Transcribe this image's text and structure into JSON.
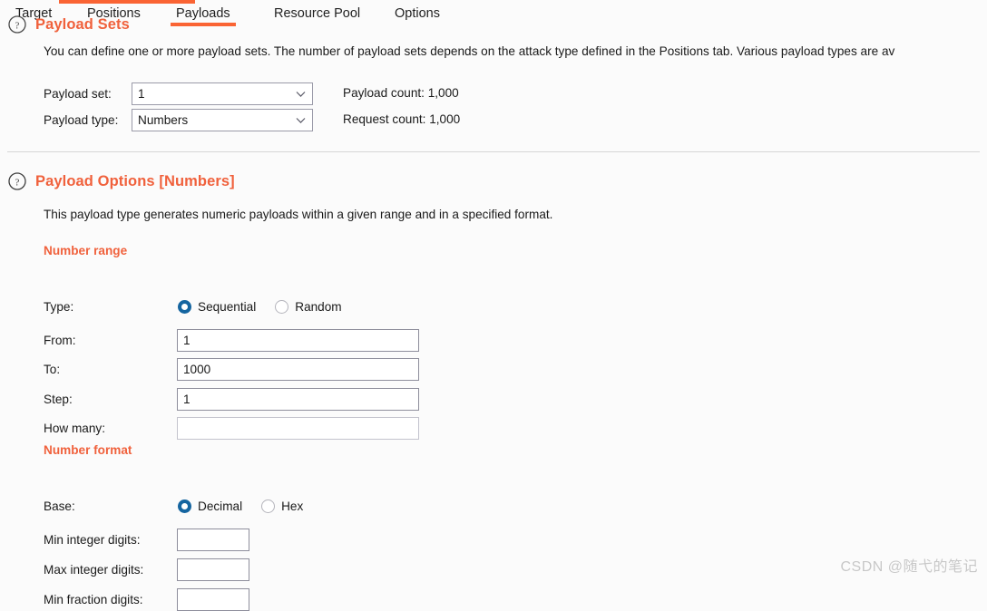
{
  "tabs": [
    {
      "label": "Target",
      "active": false
    },
    {
      "label": "Positions",
      "active": false
    },
    {
      "label": "Payloads",
      "active": true
    },
    {
      "label": "Resource Pool",
      "active": false
    },
    {
      "label": "Options",
      "active": false
    }
  ],
  "payload_sets": {
    "title": "Payload Sets",
    "help_icon": "question-circle-icon",
    "description": "You can define one or more payload sets. The number of payload sets depends on the attack type defined in the Positions tab. Various payload types are av",
    "payload_set": {
      "label": "Payload set:",
      "value": "1",
      "chevron_icon": "chevron-down-icon"
    },
    "payload_type": {
      "label": "Payload type:",
      "value": "Numbers",
      "chevron_icon": "chevron-down-icon"
    },
    "payload_count": "Payload count: 1,000",
    "request_count": "Request count: 1,000"
  },
  "payload_options": {
    "title": "Payload Options [Numbers]",
    "help_icon": "question-circle-icon",
    "description": "This payload type generates numeric payloads within a given range and in a specified format.",
    "number_range": {
      "heading": "Number range",
      "type": {
        "label": "Type:",
        "options": [
          {
            "label": "Sequential",
            "selected": true
          },
          {
            "label": "Random",
            "selected": false
          }
        ]
      },
      "fields": [
        {
          "label": "From:",
          "value": "1",
          "enabled": true
        },
        {
          "label": "To:",
          "value": "1000",
          "enabled": true
        },
        {
          "label": "Step:",
          "value": "1",
          "enabled": true
        },
        {
          "label": "How many:",
          "value": "",
          "enabled": false
        }
      ]
    },
    "number_format": {
      "heading": "Number format",
      "base": {
        "label": "Base:",
        "options": [
          {
            "label": "Decimal",
            "selected": true
          },
          {
            "label": "Hex",
            "selected": false
          }
        ]
      },
      "fields": [
        {
          "label": "Min integer digits:",
          "value": ""
        },
        {
          "label": "Max integer digits:",
          "value": ""
        },
        {
          "label": "Min fraction digits:",
          "value": ""
        }
      ]
    }
  },
  "watermark": "CSDN @随弋的笔记",
  "colors": {
    "accent": "#fa6434",
    "heading": "#f0613c",
    "radio_selected": "#1565a0",
    "background": "#fbfbfb"
  }
}
